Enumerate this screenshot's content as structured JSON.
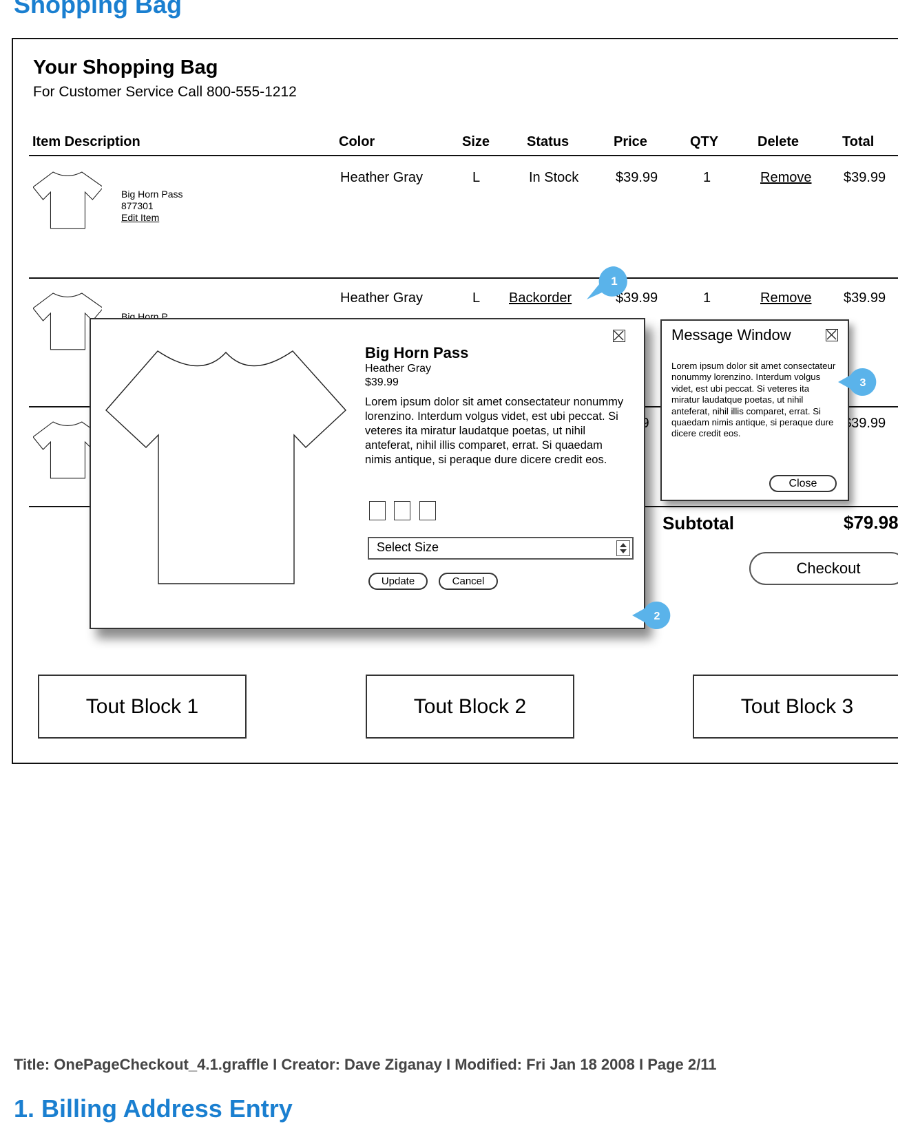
{
  "doc": {
    "section_title": "Shopping Bag",
    "next_section_title": "1. Billing Address Entry",
    "footer_meta": "Title: OnePageCheckout_4.1.graffle  I  Creator: Dave Ziganay  I  Modified: Fri Jan 18 2008  I  Page 2/11"
  },
  "bag": {
    "title": "Your Shopping Bag",
    "subtitle": "For Customer Service Call 800-555-1212",
    "columns": [
      "Item Description",
      "Color",
      "Size",
      "Status",
      "Price",
      "QTY",
      "Delete",
      "Total"
    ],
    "rows": [
      {
        "name": "Big Horn Pass",
        "sku": "877301",
        "edit_label": "Edit Item",
        "color": "Heather Gray",
        "size": "L",
        "status": "In Stock",
        "price": "$39.99",
        "qty": "1",
        "delete_label": "Remove",
        "total": "$39.99"
      },
      {
        "name_partial": "Big Horn P",
        "color": "Heather Gray",
        "size": "L",
        "status": "Backorder",
        "price": "$39.99",
        "qty": "1",
        "delete_label": "Remove",
        "total": "$39.99"
      },
      {
        "price_partial": ".9",
        "total": "$39.99"
      }
    ],
    "subtotal_label": "Subtotal",
    "subtotal_value": "$79.98",
    "checkout_label": "Checkout"
  },
  "product_modal": {
    "name": "Big Horn Pass",
    "color": "Heather Gray",
    "price": "$39.99",
    "description": "Lorem ipsum dolor sit amet consectateur nonummy lorenzino. Interdum volgus videt, est ubi peccat. Si veteres ita miratur laudatque poetas, ut nihil anteferat, nihil illis comparet, errat. Si quaedam nimis antique, si peraque dure dicere credit eos.",
    "size_select": "Select Size",
    "update_label": "Update",
    "cancel_label": "Cancel"
  },
  "message_window": {
    "title": "Message Window",
    "body": "Lorem ipsum dolor sit amet consectateur nonummy lorenzino. Interdum volgus videt, est ubi peccat. Si veteres ita miratur laudatque poetas, ut nihil anteferat, nihil illis comparet, errat. Si quaedam nimis antique, si peraque dure dicere credit eos.",
    "close_label": "Close"
  },
  "callouts": [
    "1",
    "2",
    "3"
  ],
  "touts": [
    "Tout Block 1",
    "Tout Block 2",
    "Tout Block 3"
  ],
  "colors": {
    "heading_blue": "#1a7fd0",
    "callout_blue": "#5ab3ea"
  },
  "icons": {
    "tshirt": "tshirt-icon",
    "close": "close-x-icon",
    "stepper": "up-down-stepper-icon"
  }
}
